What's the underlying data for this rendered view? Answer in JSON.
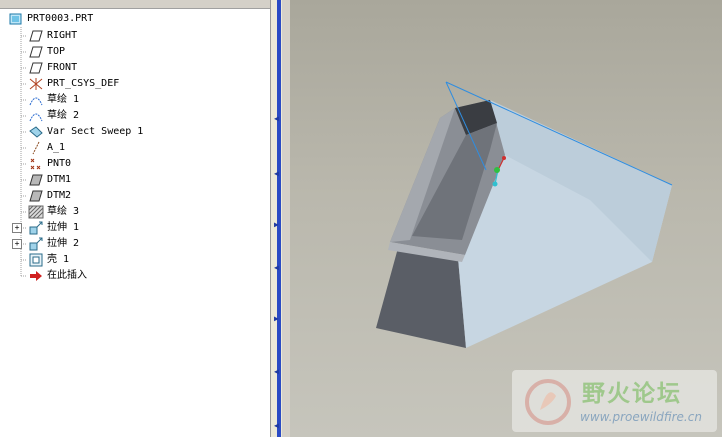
{
  "model_tree": {
    "root": {
      "label": "PRT0003.PRT",
      "icon": "part-icon"
    },
    "items": [
      {
        "label": "RIGHT",
        "icon": "datum-plane-icon",
        "expandable": false
      },
      {
        "label": "TOP",
        "icon": "datum-plane-icon",
        "expandable": false
      },
      {
        "label": "FRONT",
        "icon": "datum-plane-icon",
        "expandable": false
      },
      {
        "label": "PRT_CSYS_DEF",
        "icon": "coordinate-system-icon",
        "expandable": false
      },
      {
        "label": "草绘 1",
        "icon": "sketch-icon",
        "expandable": false
      },
      {
        "label": "草绘 2",
        "icon": "sketch-icon",
        "expandable": false
      },
      {
        "label": "Var Sect Sweep 1",
        "icon": "sweep-icon",
        "expandable": false
      },
      {
        "label": "A_1",
        "icon": "datum-axis-icon",
        "expandable": false
      },
      {
        "label": "PNT0",
        "icon": "datum-point-icon",
        "expandable": false
      },
      {
        "label": "DTM1",
        "icon": "datum-plane-shaded-icon",
        "expandable": false
      },
      {
        "label": "DTM2",
        "icon": "datum-plane-shaded-icon",
        "expandable": false
      },
      {
        "label": "草绘 3",
        "icon": "hatched-sketch-icon",
        "expandable": false
      },
      {
        "label": "拉伸 1",
        "icon": "extrude-icon",
        "expandable": true
      },
      {
        "label": "拉伸 2",
        "icon": "extrude-icon",
        "expandable": true
      },
      {
        "label": "壳 1",
        "icon": "shell-icon",
        "expandable": false
      },
      {
        "label": "在此插入",
        "icon": "insert-here-arrow-icon",
        "expandable": false
      }
    ]
  },
  "watermark": {
    "title": "野火论坛",
    "url": "www.proewildfire.cn"
  },
  "colors": {
    "viewport_top": "#a9a79b",
    "viewport_bottom": "#c6c5bc",
    "datum_line": "#2f8de0",
    "sash": "#2b4bc4"
  }
}
